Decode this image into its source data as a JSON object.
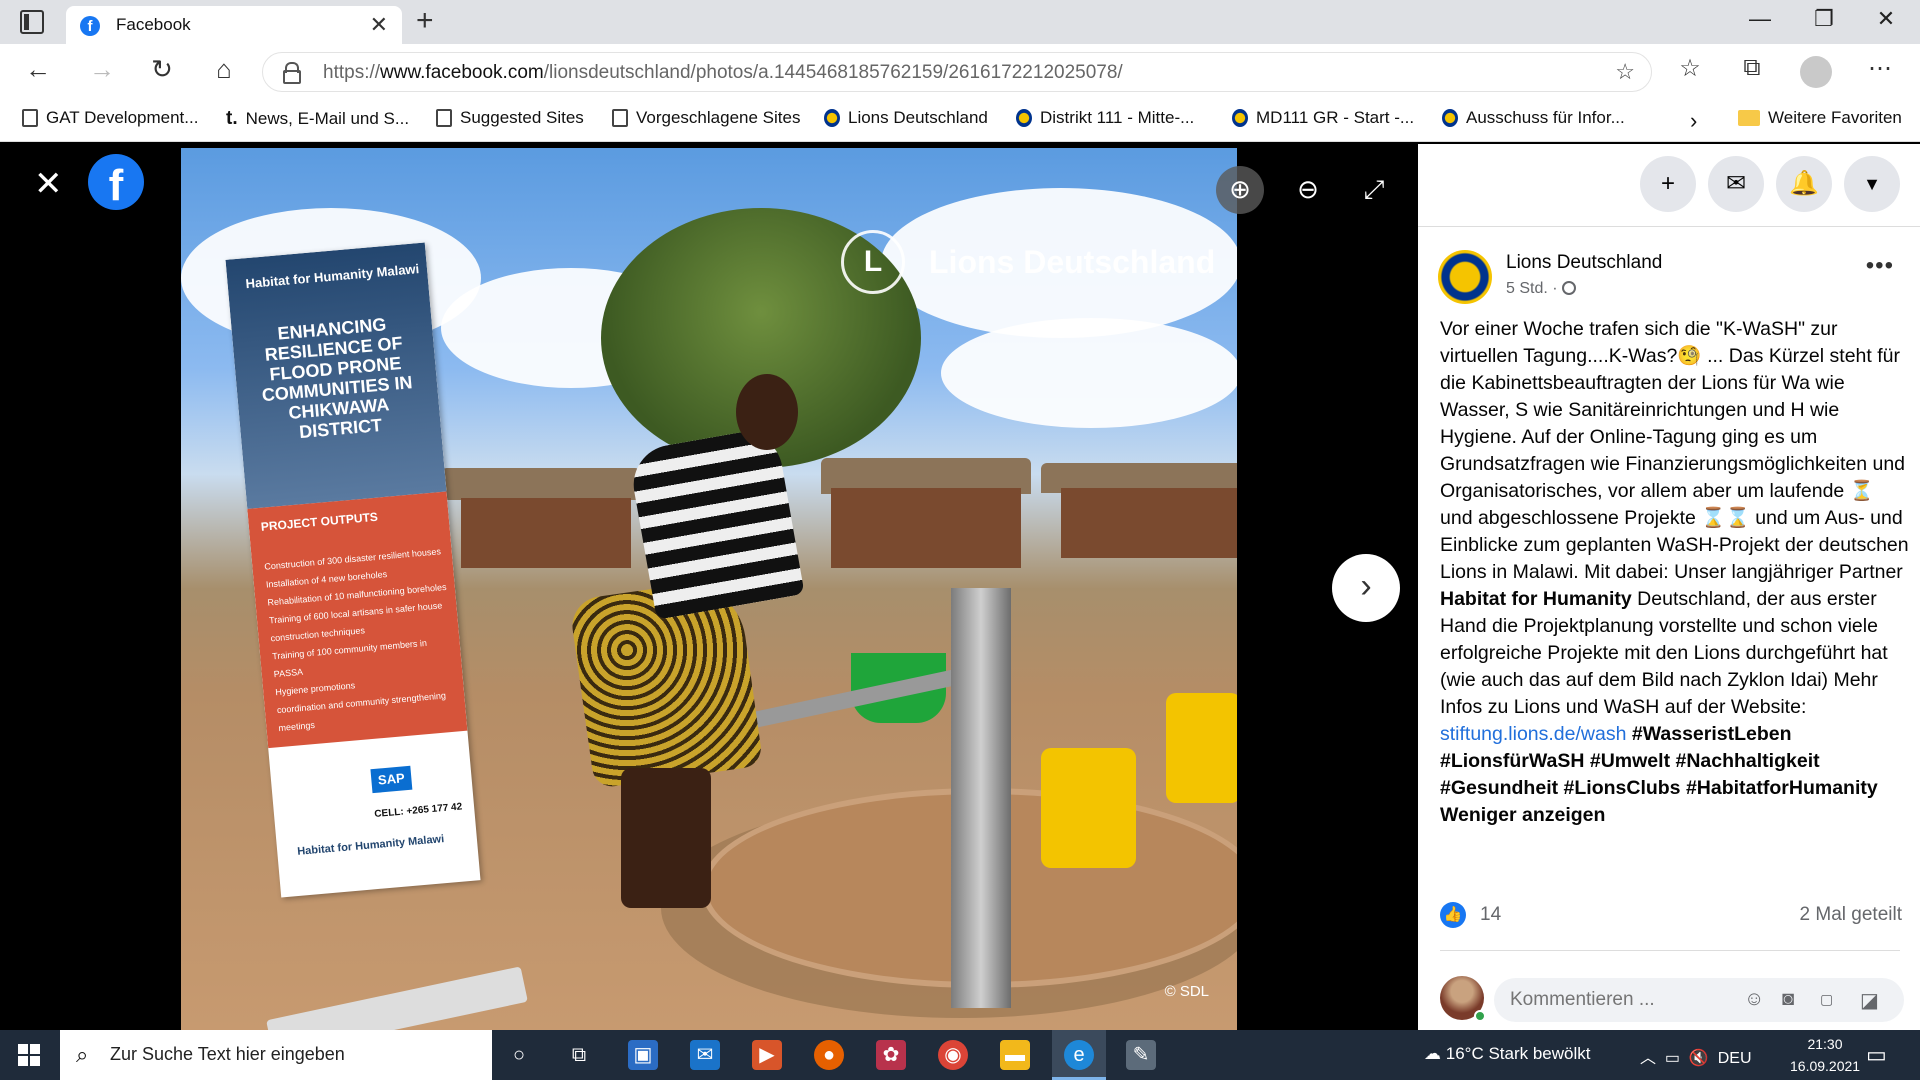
{
  "browser": {
    "tab_title": "Facebook",
    "url_prefix": "https://",
    "url_host": "www.facebook.com",
    "url_path": "/lionsdeutschland/photos/a.1445468185762159/2616172212025078/"
  },
  "favorites": [
    {
      "label": "GAT Development...",
      "icon": "page-icon"
    },
    {
      "label": "News, E-Mail und S...",
      "icon": "t-online-icon"
    },
    {
      "label": "Suggested Sites",
      "icon": "page-icon"
    },
    {
      "label": "Vorgeschlagene Sites",
      "icon": "page-icon"
    },
    {
      "label": "Lions Deutschland",
      "icon": "lions-icon"
    },
    {
      "label": "Distrikt 111 - Mitte-...",
      "icon": "lions-icon"
    },
    {
      "label": "MD111 GR - Start -...",
      "icon": "lions-icon"
    },
    {
      "label": "Ausschuss für Infor...",
      "icon": "lions-icon"
    },
    {
      "label": "Weitere Favoriten",
      "icon": "folder-icon"
    }
  ],
  "photo": {
    "watermark": "Lions Deutschland",
    "credit": "© SDL",
    "banner": {
      "org": "Habitat for Humanity Malawi",
      "headline": "ENHANCING RESILIENCE OF FLOOD PRONE COMMUNITIES IN CHIKWAWA DISTRICT",
      "outputs_title": "PROJECT OUTPUTS",
      "outputs": [
        "Construction of 300 disaster resilient houses",
        "Installation of 4 new boreholes",
        "Rehabilitation of 10 malfunctioning boreholes",
        "Training of 600 local artisans in safer house construction techniques",
        "Training of 100 community members in PASSA",
        "Hygiene promotions",
        "coordination and community strengthening meetings"
      ],
      "sponsor": "SAP",
      "cell": "CELL: +265 177 42"
    }
  },
  "post": {
    "page_name": "Lions Deutschland",
    "time": "5 Std. ·",
    "text_1": "Vor einer Woche trafen sich die \"K-WaSH\" zur virtuellen Tagung....K-Was?🧐 ... Das Kürzel steht für die Kabinettsbeauftragten der Lions für Wa wie Wasser, S wie Sanitäreinrichtungen und H wie Hygiene. Auf der Online-Tagung ging es um Grundsatzfragen wie Finanzierungsmöglichkeiten und Organisatorisches, vor allem aber um laufende ⏳ und abgeschlossene Projekte ⌛⌛ und um Aus- und Einblicke zum geplanten WaSH-Projekt der deutschen Lions in Malawi. Mit dabei: Unser langjähriger Partner ",
    "partner": "Habitat for Humanity",
    "text_2": " Deutschland, der aus erster Hand die Projektplanung vorstellte und schon viele erfolgreiche Projekte mit den Lions durchgeführt hat (wie auch das auf dem Bild nach Zyklon Idai) Mehr Infos zu Lions und WaSH auf der Website: ",
    "link": "stiftung.lions.de/wash",
    "hashtags": "#WasseristLeben #LionsfürWaSH #Umwelt #Nachhaltigkeit #Gesundheit #LionsClubs #HabitatforHumanity",
    "show_less": "Weniger anzeigen",
    "likes": "14",
    "shares": "2 Mal geteilt",
    "comment_placeholder": "Kommentieren ..."
  },
  "taskbar": {
    "search_placeholder": "Zur Suche Text hier eingeben",
    "weather": "16°C  Stark bewölkt",
    "language": "DEU",
    "time": "21:30",
    "date": "16.09.2021"
  }
}
